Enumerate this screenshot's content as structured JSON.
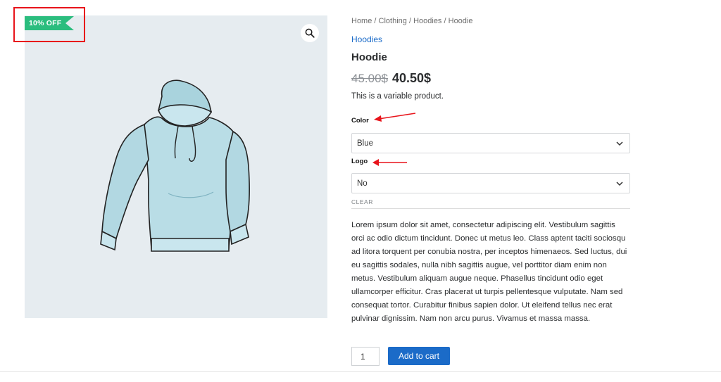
{
  "badge": {
    "label": "10% OFF",
    "color": "#2bbd7e"
  },
  "gallery": {
    "zoom_icon": "magnifier-icon",
    "image_subject": "hoodie-illustration"
  },
  "breadcrumb": {
    "items": [
      "Home",
      "Clothing",
      "Hoodies",
      "Hoodie"
    ],
    "separator": "/"
  },
  "product": {
    "category": "Hoodies",
    "title": "Hoodie",
    "price_old": "45.00$",
    "price_new": "40.50$",
    "short_description": "This is a variable product."
  },
  "variations": {
    "color": {
      "label": "Color",
      "selected": "Blue"
    },
    "logo": {
      "label": "Logo",
      "selected": "No"
    },
    "clear_label": "CLEAR"
  },
  "description": "Lorem ipsum dolor sit amet, consectetur adipiscing elit. Vestibulum sagittis orci ac odio dictum tincidunt. Donec ut metus leo. Class aptent taciti sociosqu ad litora torquent per conubia nostra, per inceptos himenaeos. Sed luctus, dui eu sagittis sodales, nulla nibh sagittis augue, vel porttitor diam enim non metus. Vestibulum aliquam augue neque. Phasellus tincidunt odio eget ullamcorper efficitur. Cras placerat ut turpis pellentesque vulputate. Nam sed consequat tortor. Curabitur finibus sapien dolor. Ut eleifend tellus nec erat pulvinar dignissim. Nam non arcu purus. Vivamus et massa massa.",
  "cart": {
    "quantity": "1",
    "button_label": "Add to cart"
  },
  "colors": {
    "accent": "#1b6bc8",
    "annotation": "#e8141b",
    "gallery_bg": "#e6ecf0",
    "hoodie": "#b9dde6"
  }
}
